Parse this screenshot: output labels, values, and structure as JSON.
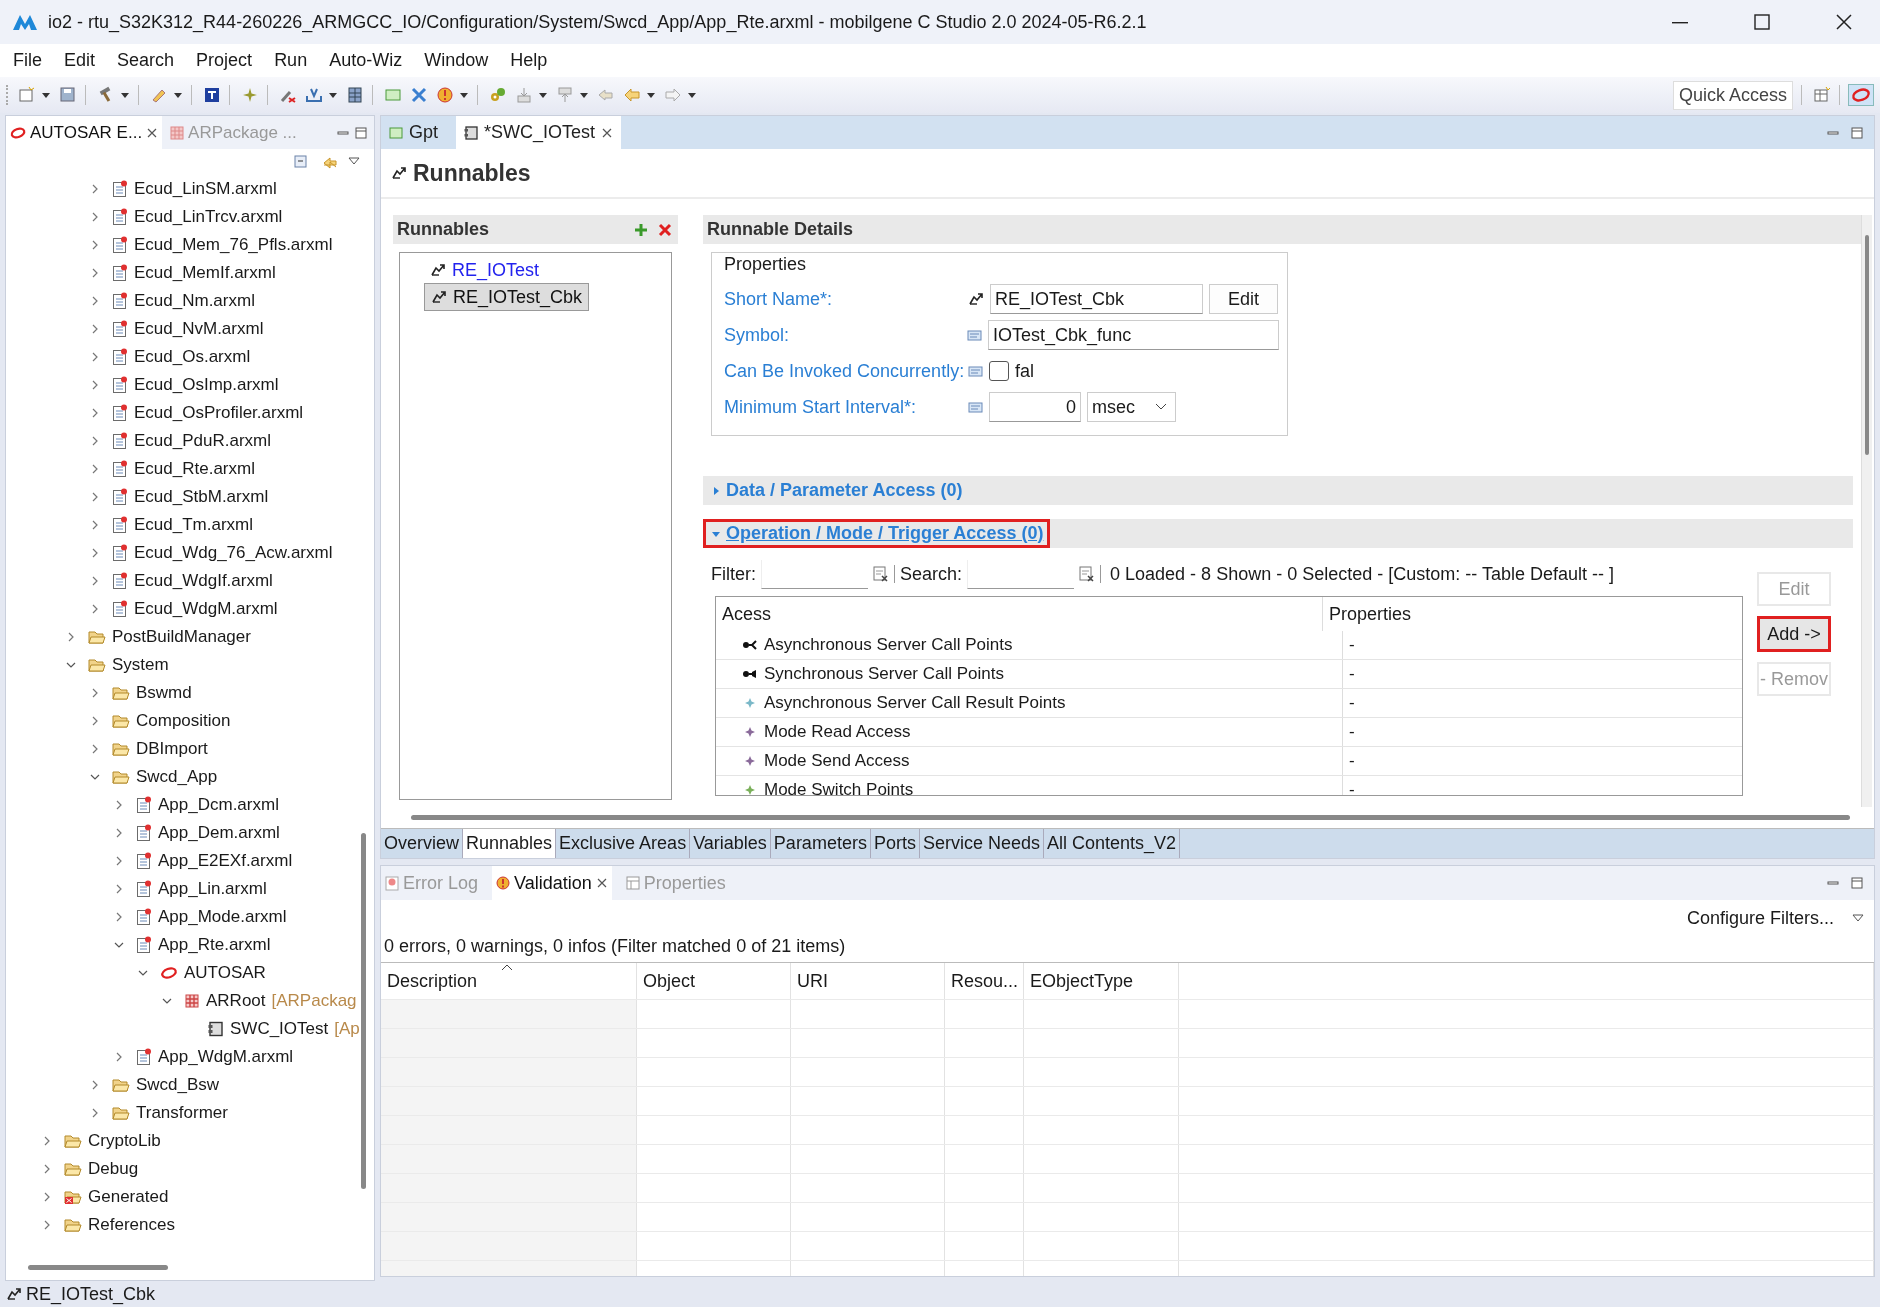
{
  "window": {
    "title": "io2 - rtu_S32K312_R44-260226_ARMGCC_IO/Configuration/System/Swcd_App/App_Rte.arxml - mobilgene C Studio 2.0 2024-05-R6.2.1"
  },
  "menu": [
    "File",
    "Edit",
    "Search",
    "Project",
    "Run",
    "Auto-Wiz",
    "Window",
    "Help"
  ],
  "toolbar": {
    "quick_access": "Quick Access"
  },
  "left_panel": {
    "tabs": [
      {
        "label": "AUTOSAR E...",
        "selected": true
      },
      {
        "label": "ARPackage ...",
        "selected": false
      }
    ],
    "tree": [
      {
        "children": [
          {
            "children": [
              {
                "label": "Ecud_LinSM.arxml",
                "kind": "file",
                "expanded": false
              },
              {
                "label": "Ecud_LinTrcv.arxml",
                "kind": "file",
                "expanded": false
              },
              {
                "label": "Ecud_Mem_76_Pfls.arxml",
                "kind": "file",
                "expanded": false
              },
              {
                "label": "Ecud_MemIf.arxml",
                "kind": "file",
                "expanded": false
              },
              {
                "label": "Ecud_Nm.arxml",
                "kind": "file",
                "expanded": false
              },
              {
                "label": "Ecud_NvM.arxml",
                "kind": "file",
                "expanded": false
              },
              {
                "label": "Ecud_Os.arxml",
                "kind": "file",
                "expanded": false
              },
              {
                "label": "Ecud_OsImp.arxml",
                "kind": "file",
                "expanded": false
              },
              {
                "label": "Ecud_OsProfiler.arxml",
                "kind": "file",
                "expanded": false
              },
              {
                "label": "Ecud_PduR.arxml",
                "kind": "file",
                "expanded": false
              },
              {
                "label": "Ecud_Rte.arxml",
                "kind": "file",
                "expanded": false
              },
              {
                "label": "Ecud_StbM.arxml",
                "kind": "file",
                "expanded": false
              },
              {
                "label": "Ecud_Tm.arxml",
                "kind": "file",
                "expanded": false
              },
              {
                "label": "Ecud_Wdg_76_Acw.arxml",
                "kind": "file",
                "expanded": false
              },
              {
                "label": "Ecud_WdgIf.arxml",
                "kind": "file",
                "expanded": false
              },
              {
                "label": "Ecud_WdgM.arxml",
                "kind": "file",
                "expanded": false
              }
            ]
          },
          {
            "label": "PostBuildManager",
            "kind": "folder",
            "expanded": false
          },
          {
            "label": "System",
            "kind": "folder",
            "expanded": true,
            "children": [
              {
                "label": "Bswmd",
                "kind": "folder",
                "expanded": false
              },
              {
                "label": "Composition",
                "kind": "folder",
                "expanded": false
              },
              {
                "label": "DBImport",
                "kind": "folder",
                "expanded": false
              },
              {
                "label": "Swcd_App",
                "kind": "folder",
                "expanded": true,
                "children": [
                  {
                    "label": "App_Dcm.arxml",
                    "kind": "file",
                    "expanded": false
                  },
                  {
                    "label": "App_Dem.arxml",
                    "kind": "file",
                    "expanded": false
                  },
                  {
                    "label": "App_E2EXf.arxml",
                    "kind": "file",
                    "expanded": false
                  },
                  {
                    "label": "App_Lin.arxml",
                    "kind": "file",
                    "expanded": false
                  },
                  {
                    "label": "App_Mode.arxml",
                    "kind": "file",
                    "expanded": false
                  },
                  {
                    "label": "App_Rte.arxml",
                    "kind": "file",
                    "expanded": true,
                    "children": [
                      {
                        "label": "AUTOSAR",
                        "kind": "autosar",
                        "expanded": true,
                        "children": [
                          {
                            "label": "ARRoot",
                            "suffix": "[ARPackag",
                            "kind": "package",
                            "expanded": true,
                            "children": [
                              {
                                "label": "SWC_IOTest",
                                "suffix": "[Ap",
                                "kind": "component"
                              }
                            ]
                          }
                        ]
                      }
                    ]
                  },
                  {
                    "label": "App_WdgM.arxml",
                    "kind": "file",
                    "expanded": false
                  }
                ]
              },
              {
                "label": "Swcd_Bsw",
                "kind": "folder",
                "expanded": false
              },
              {
                "label": "Transformer",
                "kind": "folder",
                "expanded": false
              }
            ]
          }
        ]
      },
      {
        "label": "CryptoLib",
        "kind": "folder",
        "expanded": false
      },
      {
        "label": "Debug",
        "kind": "folder",
        "expanded": false
      },
      {
        "label": "Generated",
        "kind": "generated",
        "expanded": false
      },
      {
        "label": "References",
        "kind": "folder",
        "expanded": false
      }
    ]
  },
  "editor": {
    "tabs": [
      {
        "label": "Gpt",
        "selected": false
      },
      {
        "label": "*SWC_IOTest",
        "selected": true
      }
    ],
    "page_title": "Runnables",
    "runnables": {
      "title": "Runnables",
      "items": [
        {
          "label": "RE_IOTest",
          "selected": false
        },
        {
          "label": "RE_IOTest_Cbk",
          "selected": true
        }
      ]
    },
    "details": {
      "title": "Runnable Details",
      "properties_title": "Properties",
      "short_name": {
        "label": "Short Name*:",
        "value": "RE_IOTest_Cbk",
        "button": "Edit"
      },
      "symbol": {
        "label": "Symbol:",
        "value": "IOTest_Cbk_func"
      },
      "concurrent": {
        "label": "Can Be Invoked Concurrently:",
        "checked": false,
        "text": "fal"
      },
      "min_start": {
        "label": "Minimum Start Interval*:",
        "value": "0",
        "unit": "msec"
      },
      "sections": [
        {
          "title": "Data / Parameter Access (0)",
          "expanded": false,
          "highlighted": false
        },
        {
          "title": "Operation / Mode / Trigger Access (0)",
          "expanded": true,
          "highlighted": true
        }
      ],
      "filter_label": "Filter:",
      "search_label": "Search:",
      "summary": "0 Loaded - 8 Shown - 0 Selected -  [Custom: -- Table Default -- ]",
      "columns": [
        "Acess",
        "Properties"
      ],
      "rows": [
        {
          "access": "Asynchronous Server Call Points",
          "kind": "async",
          "properties": "-"
        },
        {
          "access": "Synchronous Server Call Points",
          "kind": "sync",
          "properties": "-"
        },
        {
          "access": "Asynchronous Server Call Result Points",
          "kind": "result",
          "properties": "-"
        },
        {
          "access": "Mode Read Access",
          "kind": "mode",
          "properties": "-"
        },
        {
          "access": "Mode Send Access",
          "kind": "mode",
          "properties": "-"
        },
        {
          "access": "Mode Switch Points",
          "kind": "switch",
          "properties": "-"
        }
      ],
      "buttons": [
        {
          "label": "Edit",
          "disabled": true,
          "highlighted": false
        },
        {
          "label": "Add ->",
          "disabled": false,
          "highlighted": true
        },
        {
          "label": "- Remov",
          "disabled": true,
          "highlighted": false
        }
      ]
    },
    "page_tabs": [
      {
        "label": "Overview",
        "selected": false
      },
      {
        "label": "Runnables",
        "selected": true
      },
      {
        "label": "Exclusive Areas",
        "selected": false
      },
      {
        "label": "Variables",
        "selected": false
      },
      {
        "label": "Parameters",
        "selected": false
      },
      {
        "label": "Ports",
        "selected": false
      },
      {
        "label": "Service Needs",
        "selected": false
      },
      {
        "label": "All Contents_V2",
        "selected": false
      }
    ]
  },
  "bottom_panel": {
    "tabs": [
      {
        "label": "Error Log",
        "selected": false
      },
      {
        "label": "Validation",
        "selected": true
      },
      {
        "label": "Properties",
        "selected": false
      }
    ],
    "configure": "Configure Filters...",
    "summary": "0 errors, 0 warnings, 0 infos (Filter matched 0 of 21 items)",
    "columns": [
      "Description",
      "Object",
      "URI",
      "Resou...",
      "EObjectType"
    ]
  },
  "status_bar": {
    "text": "RE_IOTest_Cbk"
  }
}
